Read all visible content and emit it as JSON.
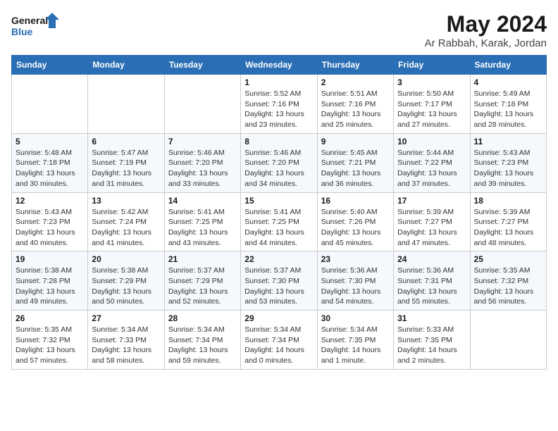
{
  "header": {
    "logo_line1": "General",
    "logo_line2": "Blue",
    "month": "May 2024",
    "location": "Ar Rabbah, Karak, Jordan"
  },
  "weekdays": [
    "Sunday",
    "Monday",
    "Tuesday",
    "Wednesday",
    "Thursday",
    "Friday",
    "Saturday"
  ],
  "weeks": [
    [
      {
        "day": "",
        "info": ""
      },
      {
        "day": "",
        "info": ""
      },
      {
        "day": "",
        "info": ""
      },
      {
        "day": "1",
        "info": "Sunrise: 5:52 AM\nSunset: 7:16 PM\nDaylight: 13 hours\nand 23 minutes."
      },
      {
        "day": "2",
        "info": "Sunrise: 5:51 AM\nSunset: 7:16 PM\nDaylight: 13 hours\nand 25 minutes."
      },
      {
        "day": "3",
        "info": "Sunrise: 5:50 AM\nSunset: 7:17 PM\nDaylight: 13 hours\nand 27 minutes."
      },
      {
        "day": "4",
        "info": "Sunrise: 5:49 AM\nSunset: 7:18 PM\nDaylight: 13 hours\nand 28 minutes."
      }
    ],
    [
      {
        "day": "5",
        "info": "Sunrise: 5:48 AM\nSunset: 7:18 PM\nDaylight: 13 hours\nand 30 minutes."
      },
      {
        "day": "6",
        "info": "Sunrise: 5:47 AM\nSunset: 7:19 PM\nDaylight: 13 hours\nand 31 minutes."
      },
      {
        "day": "7",
        "info": "Sunrise: 5:46 AM\nSunset: 7:20 PM\nDaylight: 13 hours\nand 33 minutes."
      },
      {
        "day": "8",
        "info": "Sunrise: 5:46 AM\nSunset: 7:20 PM\nDaylight: 13 hours\nand 34 minutes."
      },
      {
        "day": "9",
        "info": "Sunrise: 5:45 AM\nSunset: 7:21 PM\nDaylight: 13 hours\nand 36 minutes."
      },
      {
        "day": "10",
        "info": "Sunrise: 5:44 AM\nSunset: 7:22 PM\nDaylight: 13 hours\nand 37 minutes."
      },
      {
        "day": "11",
        "info": "Sunrise: 5:43 AM\nSunset: 7:23 PM\nDaylight: 13 hours\nand 39 minutes."
      }
    ],
    [
      {
        "day": "12",
        "info": "Sunrise: 5:43 AM\nSunset: 7:23 PM\nDaylight: 13 hours\nand 40 minutes."
      },
      {
        "day": "13",
        "info": "Sunrise: 5:42 AM\nSunset: 7:24 PM\nDaylight: 13 hours\nand 41 minutes."
      },
      {
        "day": "14",
        "info": "Sunrise: 5:41 AM\nSunset: 7:25 PM\nDaylight: 13 hours\nand 43 minutes."
      },
      {
        "day": "15",
        "info": "Sunrise: 5:41 AM\nSunset: 7:25 PM\nDaylight: 13 hours\nand 44 minutes."
      },
      {
        "day": "16",
        "info": "Sunrise: 5:40 AM\nSunset: 7:26 PM\nDaylight: 13 hours\nand 45 minutes."
      },
      {
        "day": "17",
        "info": "Sunrise: 5:39 AM\nSunset: 7:27 PM\nDaylight: 13 hours\nand 47 minutes."
      },
      {
        "day": "18",
        "info": "Sunrise: 5:39 AM\nSunset: 7:27 PM\nDaylight: 13 hours\nand 48 minutes."
      }
    ],
    [
      {
        "day": "19",
        "info": "Sunrise: 5:38 AM\nSunset: 7:28 PM\nDaylight: 13 hours\nand 49 minutes."
      },
      {
        "day": "20",
        "info": "Sunrise: 5:38 AM\nSunset: 7:29 PM\nDaylight: 13 hours\nand 50 minutes."
      },
      {
        "day": "21",
        "info": "Sunrise: 5:37 AM\nSunset: 7:29 PM\nDaylight: 13 hours\nand 52 minutes."
      },
      {
        "day": "22",
        "info": "Sunrise: 5:37 AM\nSunset: 7:30 PM\nDaylight: 13 hours\nand 53 minutes."
      },
      {
        "day": "23",
        "info": "Sunrise: 5:36 AM\nSunset: 7:30 PM\nDaylight: 13 hours\nand 54 minutes."
      },
      {
        "day": "24",
        "info": "Sunrise: 5:36 AM\nSunset: 7:31 PM\nDaylight: 13 hours\nand 55 minutes."
      },
      {
        "day": "25",
        "info": "Sunrise: 5:35 AM\nSunset: 7:32 PM\nDaylight: 13 hours\nand 56 minutes."
      }
    ],
    [
      {
        "day": "26",
        "info": "Sunrise: 5:35 AM\nSunset: 7:32 PM\nDaylight: 13 hours\nand 57 minutes."
      },
      {
        "day": "27",
        "info": "Sunrise: 5:34 AM\nSunset: 7:33 PM\nDaylight: 13 hours\nand 58 minutes."
      },
      {
        "day": "28",
        "info": "Sunrise: 5:34 AM\nSunset: 7:34 PM\nDaylight: 13 hours\nand 59 minutes."
      },
      {
        "day": "29",
        "info": "Sunrise: 5:34 AM\nSunset: 7:34 PM\nDaylight: 14 hours\nand 0 minutes."
      },
      {
        "day": "30",
        "info": "Sunrise: 5:34 AM\nSunset: 7:35 PM\nDaylight: 14 hours\nand 1 minute."
      },
      {
        "day": "31",
        "info": "Sunrise: 5:33 AM\nSunset: 7:35 PM\nDaylight: 14 hours\nand 2 minutes."
      },
      {
        "day": "",
        "info": ""
      }
    ]
  ]
}
